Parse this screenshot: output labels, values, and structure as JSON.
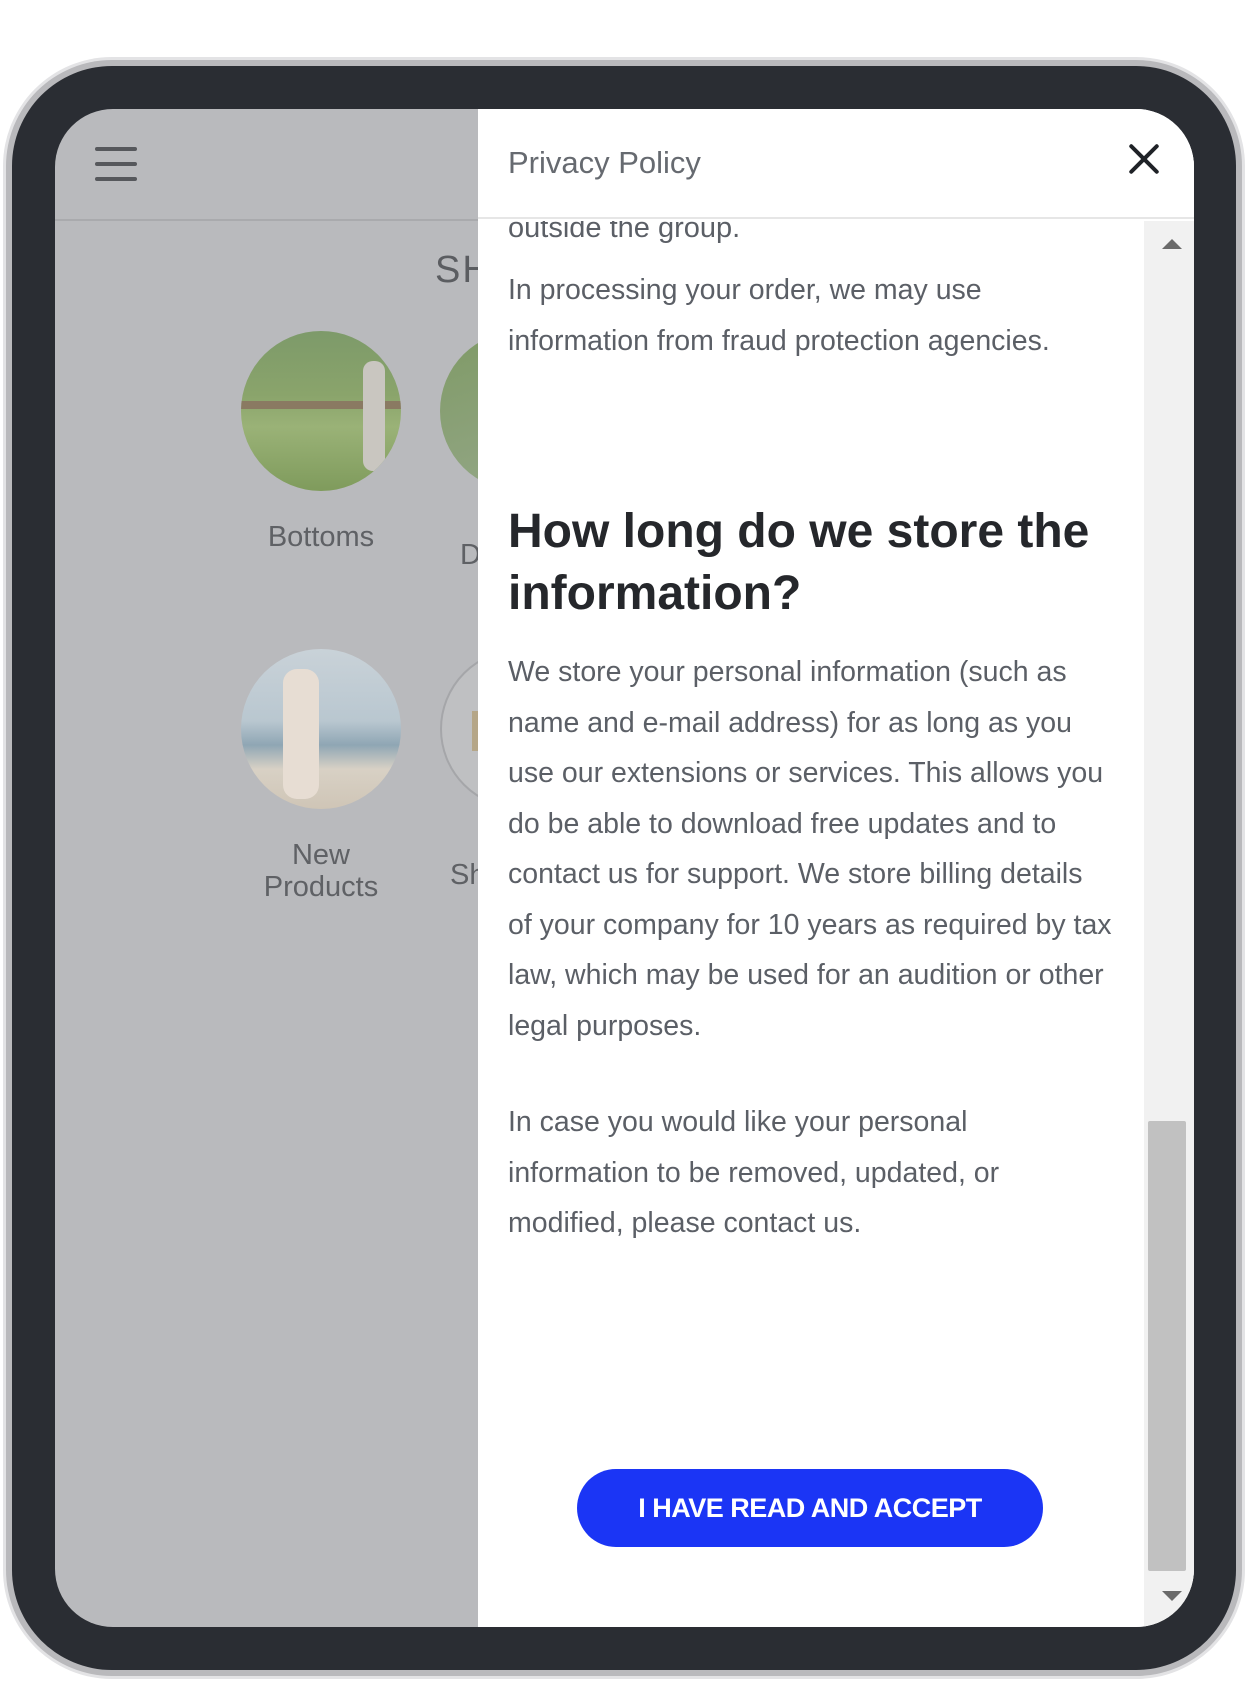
{
  "background_app": {
    "title": "SH",
    "categories": [
      {
        "label": "Bottoms"
      },
      {
        "label": "New\nProducts"
      }
    ],
    "partial_labels": [
      "D",
      "Sh"
    ]
  },
  "modal": {
    "title": "Privacy Policy",
    "cut_off_text": "outside the group.",
    "paragraph_1": "In processing your order, we may use information from fraud protection agencies.",
    "heading": "How long do we store the information?",
    "paragraph_2": "We store your personal information (such as name and e-mail address) for as long as you use our extensions or services. This allows you do be able to download free updates and to contact us for support. We store billing details of your company for 10 years as required by tax law, which may be used for an audition or other legal purposes.",
    "paragraph_3": "In case you would like your personal information to be removed, updated, or modified, please contact us.",
    "accept_button": "I HAVE READ AND ACCEPT"
  },
  "colors": {
    "accent": "#1b35f5",
    "overlay": "#b9babd",
    "device_frame": "#2a2d33"
  }
}
